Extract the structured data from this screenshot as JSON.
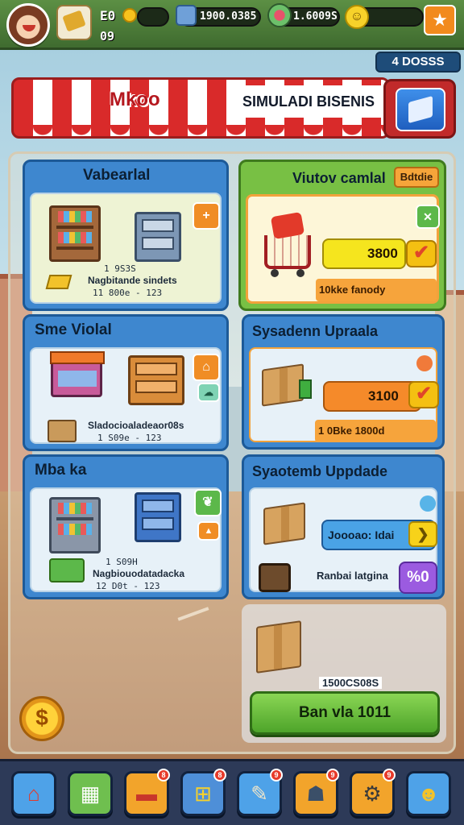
{
  "topbar": {
    "level_value": "E0",
    "level_sub": "09",
    "money_value": "1900.0385",
    "gems_value": "1.6009S"
  },
  "badge_top": "4 DOSSS",
  "header": {
    "shop_title": "Mkoo",
    "banner_text": "SIMULADI BISENIS"
  },
  "left_cards": [
    {
      "title": "Vabearlal",
      "code": "1 9S3S",
      "desc": "Nagbitande sindets",
      "sub": "11 800e - 123",
      "tag_icon": "plus-icon"
    },
    {
      "title": "Sme Violal",
      "desc": "Sladocioaladeaor08s",
      "sub": "1 S09e - 123",
      "tag_icon": "shop-icon"
    },
    {
      "title": "Mba ka",
      "code": "1 S09H",
      "desc": "Nagbiouodatadacka",
      "sub": "12 D0t - 123",
      "tag_icon": "leaf-icon"
    }
  ],
  "right_cards": [
    {
      "title": "Viutov camlal",
      "badge": "Bdtdie",
      "price": "3800",
      "sub": "10kke fanody"
    },
    {
      "title": "Sysadenn Upraala",
      "price": "3100",
      "sub": "1 0Bke 1800d"
    },
    {
      "title": "Syaotemb Uppdade",
      "pill": "Joooao: Idai",
      "row_label": "Ranbai latgina",
      "row_value": "%0"
    }
  ],
  "bottom": {
    "code": "1500CS08S",
    "action_label": "Ban vla 1011",
    "currency_symbol": "$"
  },
  "nav": [
    {
      "name": "home",
      "badge": ""
    },
    {
      "name": "gallery",
      "badge": ""
    },
    {
      "name": "cards",
      "badge": "8"
    },
    {
      "name": "shop",
      "badge": "8"
    },
    {
      "name": "tools",
      "badge": "9"
    },
    {
      "name": "robot",
      "badge": "9"
    },
    {
      "name": "settings",
      "badge": "9"
    },
    {
      "name": "character",
      "badge": ""
    }
  ]
}
